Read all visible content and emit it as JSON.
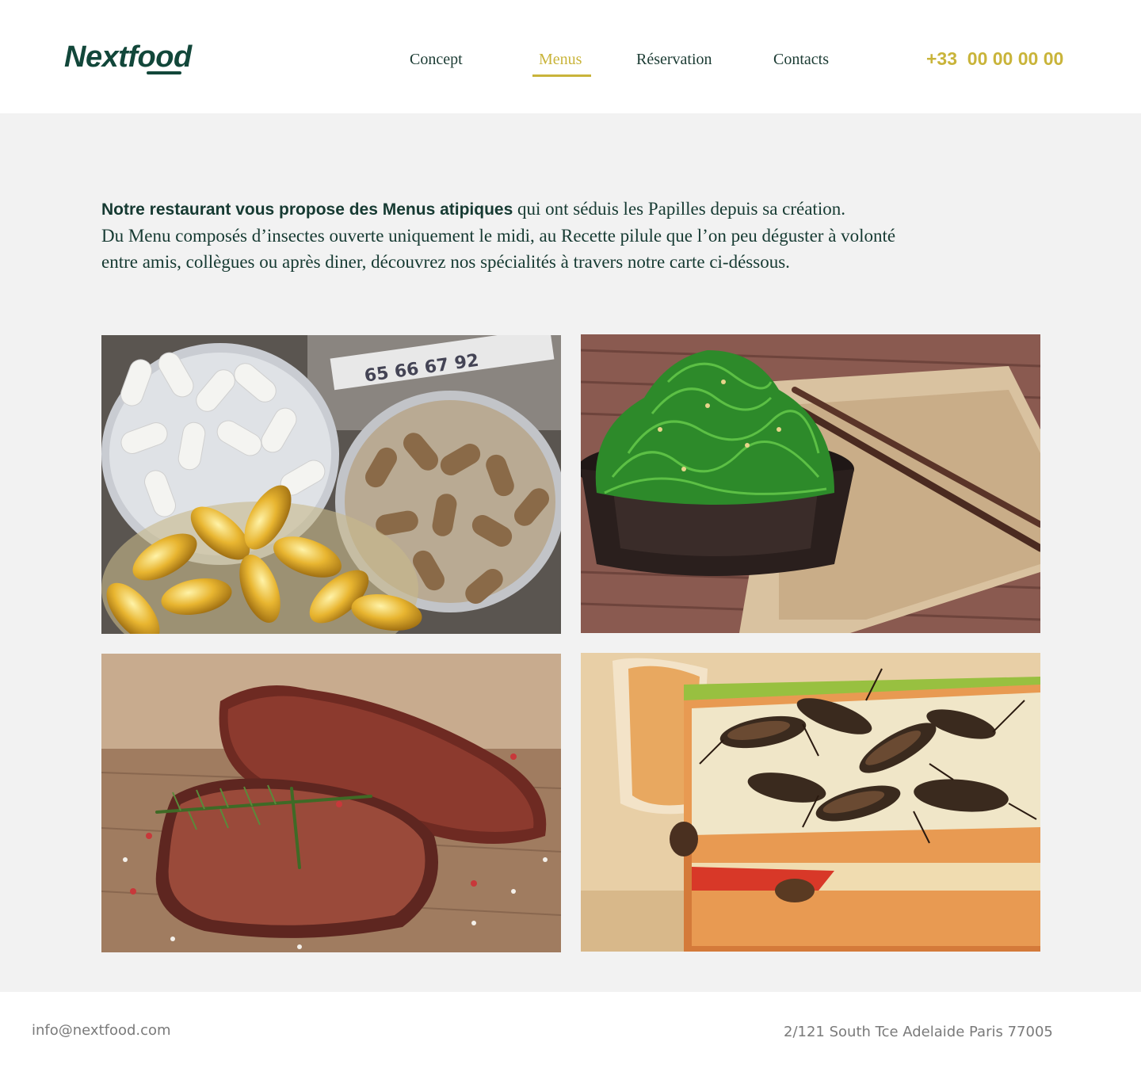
{
  "brand": {
    "name": "Nextfood"
  },
  "nav": {
    "items": [
      {
        "label": "Concept"
      },
      {
        "label": "Menus"
      },
      {
        "label": "Réservation"
      },
      {
        "label": "Contacts"
      }
    ],
    "active": "Menus"
  },
  "phone": "+33  00 00 00 00",
  "intro": {
    "bold": "Notre restaurant vous propose des Menus atipiques",
    "line1_rest": " qui ont séduis  les Papilles depuis sa création.",
    "line2": "Du Menu composés d’insectes ouverte uniquement le midi, au Recette pilule que l’on peu déguster à volonté",
    "line3": "entre amis, collègues ou après diner, découvrez nos spécialités à travers notre carte ci-déssous."
  },
  "gallery": [
    {
      "subject": "pills and capsules in glass bowls"
    },
    {
      "subject": "seaweed salad with chopsticks"
    },
    {
      "subject": "grilled steak with rosemary"
    },
    {
      "subject": "cricket sandwich"
    }
  ],
  "footer": {
    "email": "info@nextfood.com",
    "address": "2/121 South Tce Adelaide Paris 77005"
  },
  "colors": {
    "brand_green": "#12473a",
    "accent_gold": "#c9b43a",
    "background_grey": "#f2f2f2",
    "footer_text": "#7a7a7a"
  }
}
